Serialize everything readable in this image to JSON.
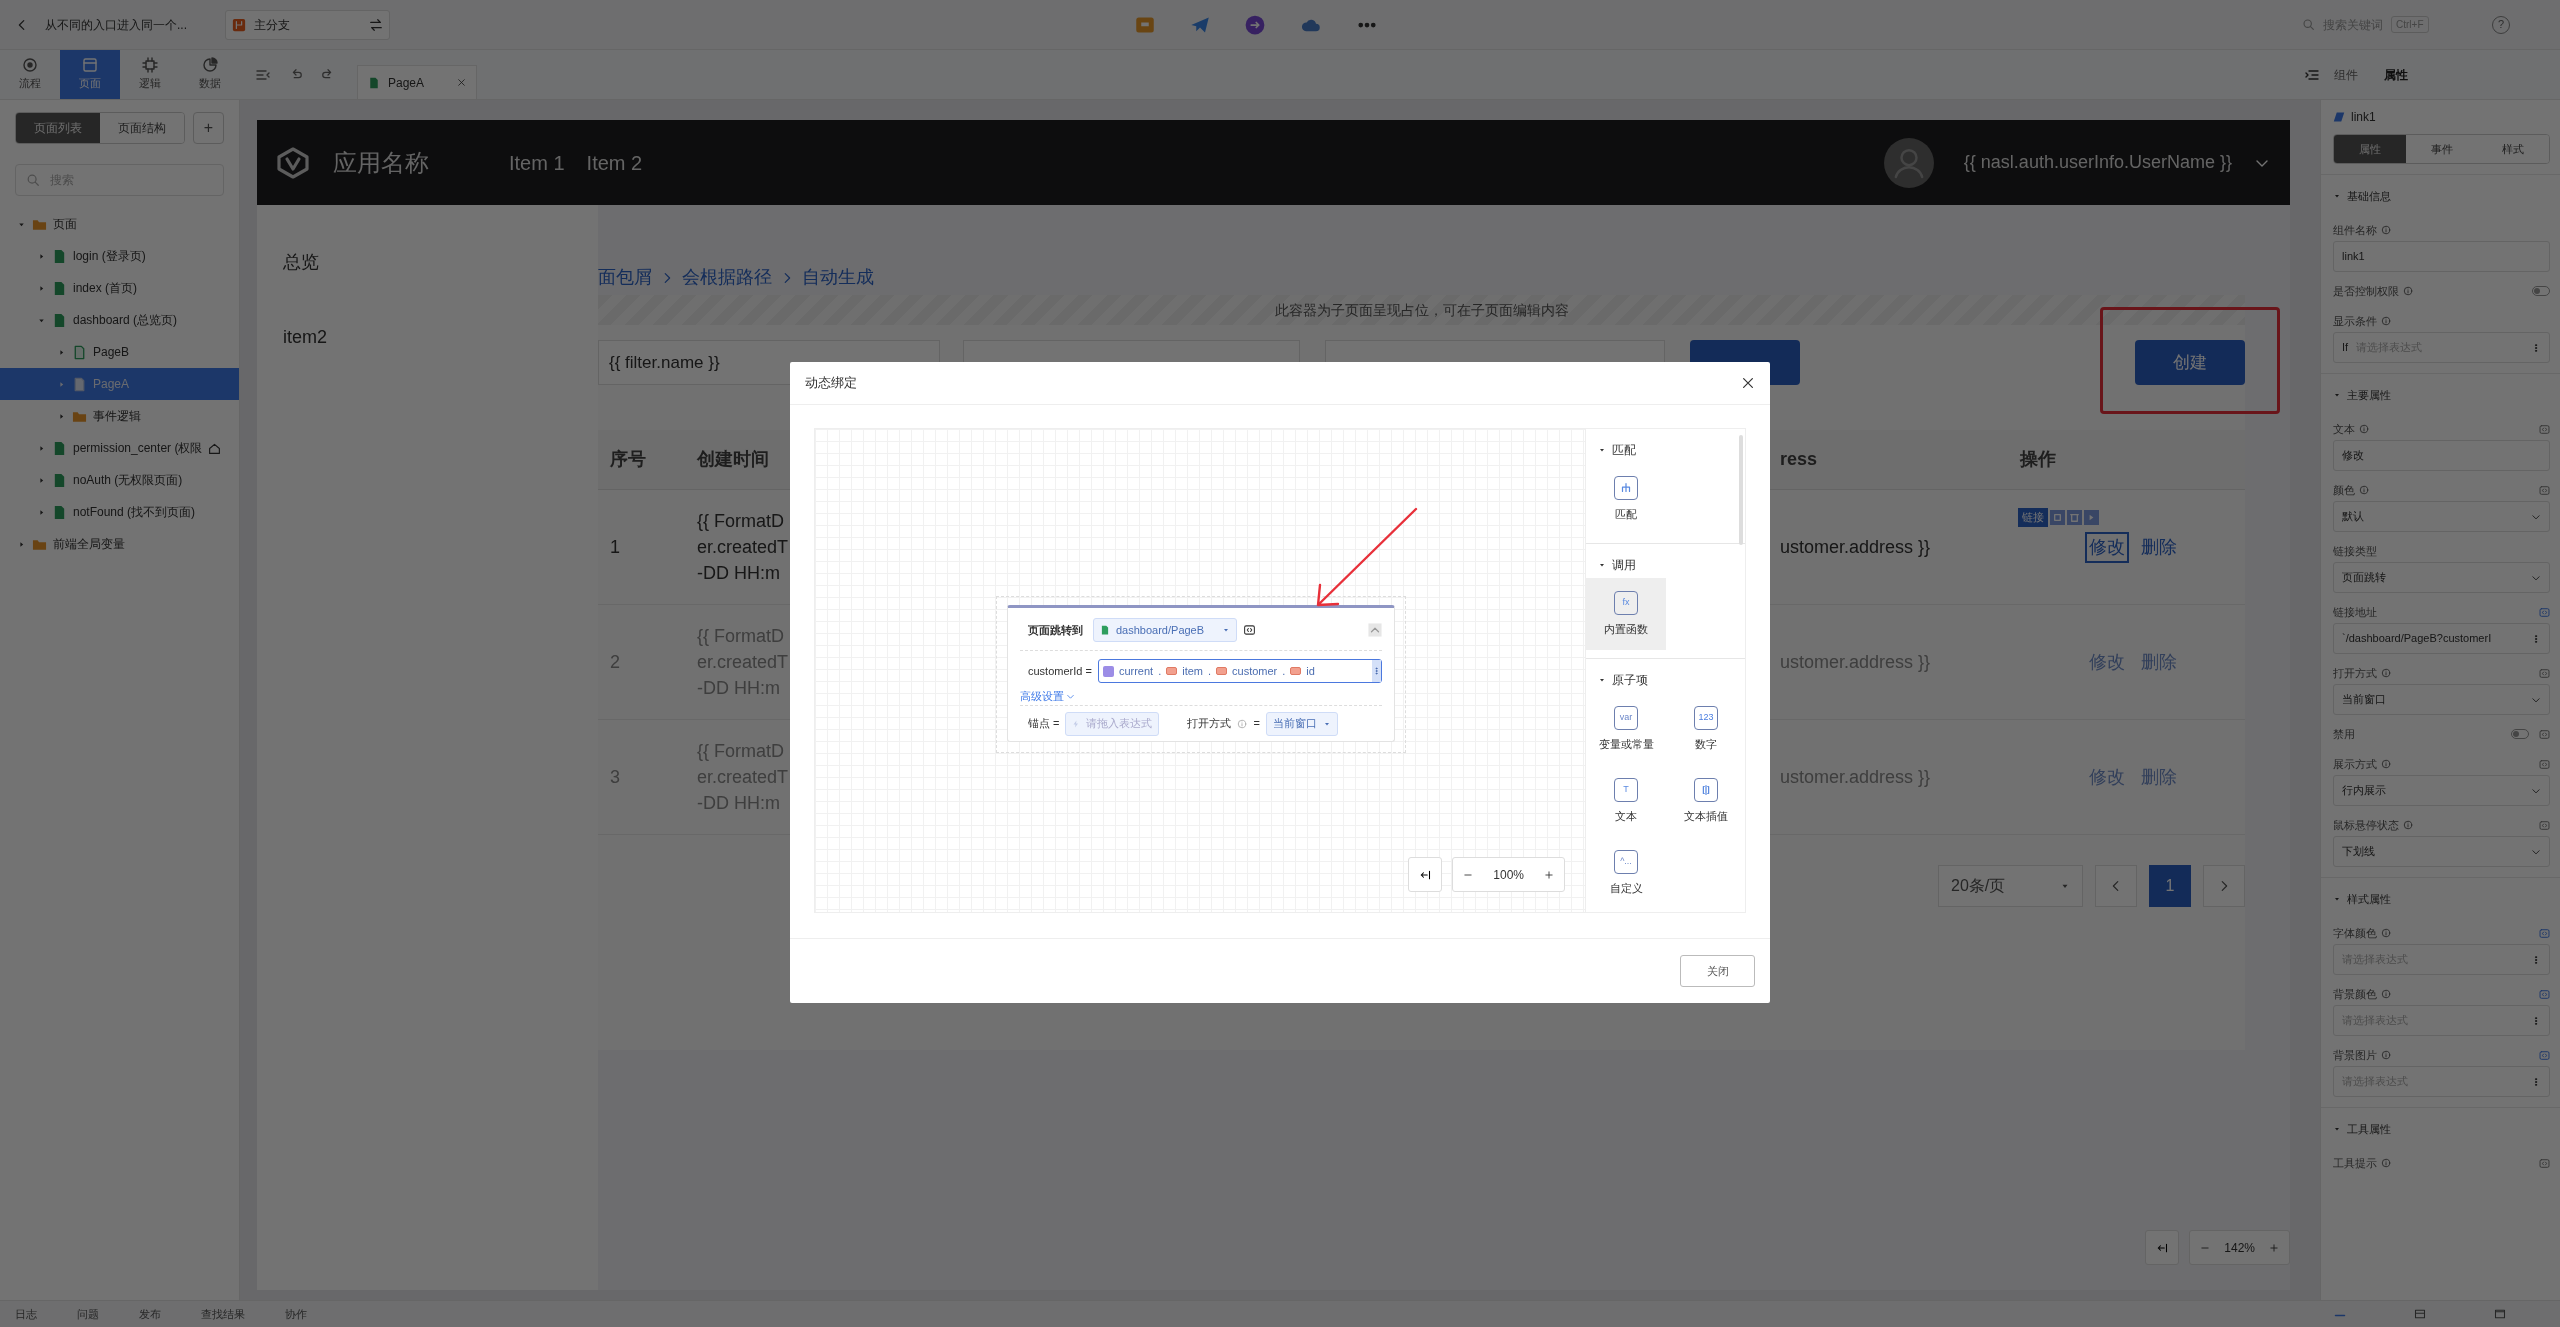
{
  "topbar": {
    "title": "从不同的入口进入同一个...",
    "branch": "主分支",
    "search_placeholder": "搜索关键词",
    "shortcut": "Ctrl+F",
    "help": "?"
  },
  "mode_tabs": [
    {
      "label": "流程",
      "selected": false
    },
    {
      "label": "页面",
      "selected": true
    },
    {
      "label": "逻辑",
      "selected": false
    },
    {
      "label": "数据",
      "selected": false
    }
  ],
  "editor_tabs": [
    {
      "label": "PageA",
      "selected": true
    }
  ],
  "inspector_tabs": [
    {
      "label": "组件",
      "selected": false
    },
    {
      "label": "属性",
      "selected": true
    }
  ],
  "sidebar": {
    "view_tabs": [
      {
        "label": "页面列表",
        "selected": true
      },
      {
        "label": "页面结构",
        "selected": false
      }
    ],
    "add": "+",
    "search_placeholder": "搜索",
    "tree": [
      {
        "label": "页面",
        "kind": "folder",
        "expanded": true,
        "selected": false,
        "home": false,
        "children": [
          {
            "label": "login (登录页)",
            "kind": "page",
            "expanded": false,
            "selected": false,
            "home": false
          },
          {
            "label": "index (首页)",
            "kind": "page",
            "expanded": false,
            "selected": false,
            "home": false
          },
          {
            "label": "dashboard (总览页)",
            "kind": "page",
            "expanded": true,
            "selected": false,
            "home": false,
            "children": [
              {
                "label": "PageB",
                "kind": "subpage",
                "expanded": false,
                "selected": false,
                "home": false
              },
              {
                "label": "PageA",
                "kind": "subpage",
                "expanded": false,
                "selected": true,
                "home": false
              },
              {
                "label": "事件逻辑",
                "kind": "folder",
                "expanded": false,
                "selected": false,
                "home": false
              }
            ]
          },
          {
            "label": "permission_center (权限",
            "kind": "page",
            "expanded": false,
            "selected": false,
            "home": true
          },
          {
            "label": "noAuth (无权限页面)",
            "kind": "page",
            "expanded": false,
            "selected": false,
            "home": false
          },
          {
            "label": "notFound (找不到页面)",
            "kind": "page",
            "expanded": false,
            "selected": false,
            "home": false
          }
        ]
      },
      {
        "label": "前端全局变量",
        "kind": "folder",
        "expanded": false,
        "selected": false,
        "home": false
      }
    ]
  },
  "preview": {
    "app_name": "应用名称",
    "nav": [
      "Item 1",
      "Item 2"
    ],
    "user": "{{ nasl.auth.userInfo.UserName }}",
    "side_nav": [
      "总览",
      "item2"
    ],
    "breadcrumb": [
      "面包屑",
      "会根据路径",
      "自动生成"
    ],
    "placeholder_note": "此容器为子页面呈现占位，可在子页面编辑内容",
    "filters": [
      "{{ filter.name }}"
    ],
    "create_button": "创建",
    "table": {
      "columns": [
        "序号",
        "创建时间",
        "ress",
        "操作"
      ],
      "rows": [
        {
          "dimmed": false,
          "index": "1",
          "time": [
            "{{ FormatD",
            "er.createdT",
            "-DD HH:m"
          ],
          "address": "ustomer.address }}",
          "actions": [
            {
              "label": "修改",
              "selected": true
            },
            {
              "label": "删除",
              "selected": false
            }
          ]
        },
        {
          "dimmed": true,
          "index": "2",
          "time": [
            "{{ FormatD",
            "er.createdT",
            "-DD HH:m"
          ],
          "address": "ustomer.address }}",
          "actions": [
            {
              "label": "修改",
              "selected": false
            },
            {
              "label": "删除",
              "selected": false
            }
          ]
        },
        {
          "dimmed": true,
          "index": "3",
          "time": [
            "{{ FormatD",
            "er.createdT",
            "-DD HH:m"
          ],
          "address": "ustomer.address }}",
          "actions": [
            {
              "label": "修改",
              "selected": false
            },
            {
              "label": "删除",
              "selected": false
            }
          ]
        }
      ]
    },
    "selection_label": "链接",
    "pagination": {
      "page_size": "20条/页",
      "pages": [
        {
          "label": "1",
          "selected": true
        }
      ]
    }
  },
  "canvas_zoom": "142%",
  "inspector": {
    "component": "link1",
    "tabs": [
      {
        "label": "属性",
        "selected": true
      },
      {
        "label": "事件",
        "selected": false
      },
      {
        "label": "样式",
        "selected": false
      }
    ],
    "sections": [
      {
        "title": "基础信息",
        "expanded": true,
        "fields": [
          {
            "label": "组件名称",
            "info": true,
            "kind": "input",
            "value": "link1"
          },
          {
            "label": "是否控制权限",
            "info": true,
            "kind": "switch",
            "on": false
          },
          {
            "label": "显示条件",
            "info": true,
            "kind": "expr",
            "prefix": "If",
            "placeholder": "请选择表达式"
          }
        ]
      },
      {
        "title": "主要属性",
        "expanded": true,
        "fields": [
          {
            "label": "文本",
            "info": true,
            "kind": "input",
            "value": "修改",
            "bound": false
          },
          {
            "label": "颜色",
            "info": true,
            "kind": "select",
            "value": "默认",
            "bound": false
          },
          {
            "label": "链接类型",
            "info": false,
            "kind": "select",
            "value": "页面跳转"
          },
          {
            "label": "链接地址",
            "info": false,
            "kind": "expr",
            "value": "`/dashboard/PageB?customerI",
            "bound": true
          },
          {
            "label": "打开方式",
            "info": true,
            "kind": "select",
            "value": "当前窗口",
            "bound": false
          },
          {
            "label": "禁用",
            "info": false,
            "kind": "switch",
            "on": false,
            "bound": false
          },
          {
            "label": "展示方式",
            "info": true,
            "kind": "select",
            "value": "行内展示",
            "bound": false
          },
          {
            "label": "鼠标悬停状态",
            "info": true,
            "kind": "select",
            "value": "下划线",
            "bound": false
          }
        ]
      },
      {
        "title": "样式属性",
        "expanded": true,
        "fields": [
          {
            "label": "字体颜色",
            "info": true,
            "kind": "expr",
            "placeholder": "请选择表达式",
            "bound": true
          },
          {
            "label": "背景颜色",
            "info": true,
            "kind": "expr",
            "placeholder": "请选择表达式",
            "bound": true
          },
          {
            "label": "背景图片",
            "info": true,
            "kind": "expr",
            "placeholder": "请选择表达式",
            "bound": true
          }
        ]
      },
      {
        "title": "工具属性",
        "expanded": true,
        "fields": [
          {
            "label": "工具提示",
            "info": true,
            "kind": "label",
            "bound": false
          }
        ]
      }
    ]
  },
  "statusbar": [
    "日志",
    "问题",
    "发布",
    "查找结果",
    "协作"
  ],
  "modal": {
    "title": "动态绑定",
    "node": {
      "title": "页面跳转到",
      "target": "dashboard/PageB",
      "param": "customerId =",
      "chain": [
        "current",
        "item",
        "customer",
        "id"
      ],
      "separator": ".",
      "advanced": "高级设置",
      "anchor_label": "锚点 =",
      "anchor_placeholder": "请拖入表达式",
      "open_label": "打开方式",
      "equals": "=",
      "open_value": "当前窗口"
    },
    "zoom": "100%",
    "palette": [
      {
        "title": "匹配",
        "expanded": true,
        "items": [
          {
            "kind": "match",
            "label": "匹配",
            "selected": false
          }
        ]
      },
      {
        "title": "调用",
        "expanded": true,
        "items": [
          {
            "kind": "function",
            "glyph": "fx",
            "label": "内置函数",
            "selected": true
          }
        ]
      },
      {
        "title": "原子项",
        "expanded": true,
        "items": [
          {
            "kind": "variable",
            "glyph": "var",
            "label": "变量或常量",
            "selected": false
          },
          {
            "kind": "number",
            "glyph": "123",
            "label": "数字",
            "selected": false
          },
          {
            "kind": "text",
            "glyph": "T",
            "label": "文本",
            "selected": false
          },
          {
            "kind": "interpolation",
            "label": "文本插值",
            "selected": false
          },
          {
            "kind": "custom",
            "glyph": "^...",
            "label": "自定义",
            "selected": false
          }
        ]
      }
    ],
    "close_button": "关闭"
  }
}
